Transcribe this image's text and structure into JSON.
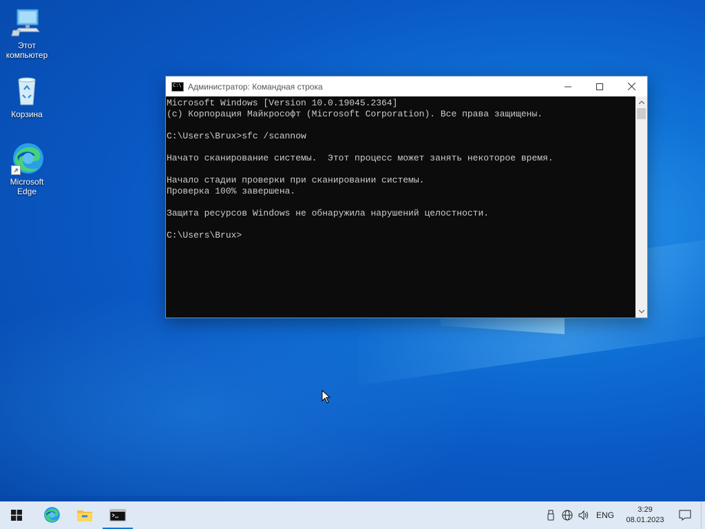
{
  "desktop": {
    "icons": [
      {
        "label": "Этот\nкомпьютер",
        "icon": "computer-icon"
      },
      {
        "label": "Корзина",
        "icon": "recycle-bin-icon"
      },
      {
        "label": "Microsoft\nEdge",
        "icon": "edge-icon"
      }
    ]
  },
  "cmd_window": {
    "title": "Администратор: Командная строка",
    "icon": "cmd-icon",
    "lines": [
      "Microsoft Windows [Version 10.0.19045.2364]",
      "(c) Корпорация Майкрософт (Microsoft Corporation). Все права защищены.",
      "",
      "C:\\Users\\Brux>sfc /scannow",
      "",
      "Начато сканирование системы.  Этот процесс может занять некоторое время.",
      "",
      "Начало стадии проверки при сканировании системы.",
      "Проверка 100% завершена.",
      "",
      "Защита ресурсов Windows не обнаружила нарушений целостности.",
      "",
      "C:\\Users\\Brux>"
    ]
  },
  "taskbar": {
    "items": [
      "start-icon",
      "edge-icon",
      "file-explorer-icon",
      "cmd-icon"
    ],
    "active": "cmd-icon",
    "tray": {
      "language": "ENG",
      "time": "3:29",
      "date": "08.01.2023"
    }
  },
  "colors": {
    "accent": "#0078d7",
    "console_bg": "#0c0c0c",
    "console_fg": "#cccccc"
  }
}
